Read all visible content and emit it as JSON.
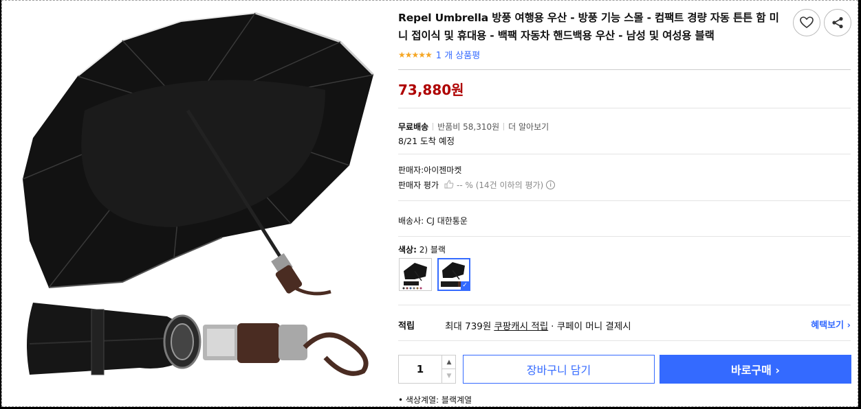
{
  "product": {
    "title": "Repel Umbrella 방풍 여행용 우산 - 방풍 기능 스몰 - 컴팩트 경량 자동 튼튼 함 미니 접이식 및 휴대용 - 백팩 자동차 핸드백용 우산 - 남성 및 여성용 블랙",
    "stars": "★★★★★",
    "rating_value": 5,
    "review_link": "1 개 상품평",
    "price": "73,880원"
  },
  "shipping": {
    "free": "무료배송",
    "return_fee": "반품비 58,310원",
    "more": "더 알아보기",
    "arrival": "8/21 도착 예정"
  },
  "seller": {
    "name": "판매자:아이젠마켓",
    "rating_label": "판매자 평가",
    "rating_value": "-- % (14건 이하의 평가)",
    "carrier": "배송사:  CJ 대한통운"
  },
  "options": {
    "color_key": "색상:",
    "color_value": "2) 블랙",
    "check_icon": "✓"
  },
  "reward": {
    "label": "적립",
    "text_pre": "최대 739원",
    "text_link": "쿠팡캐시 적립",
    "text_post": "· 쿠페이 머니 결제시",
    "benefit": "혜택보기 ›"
  },
  "purchase": {
    "quantity": "1",
    "up": "▲",
    "down": "▼",
    "cart": "장바구니 담기",
    "buy": "바로구매 ›"
  },
  "details": {
    "bullet": "•  색상계열: 블랙계열"
  },
  "colors": {
    "accent": "#346aff",
    "price": "#ae0000",
    "star": "#f5a623"
  },
  "icons": {
    "wishlist": "heart-icon",
    "share": "share-icon",
    "info": "info-icon",
    "thumb": "thumb-up-icon"
  }
}
